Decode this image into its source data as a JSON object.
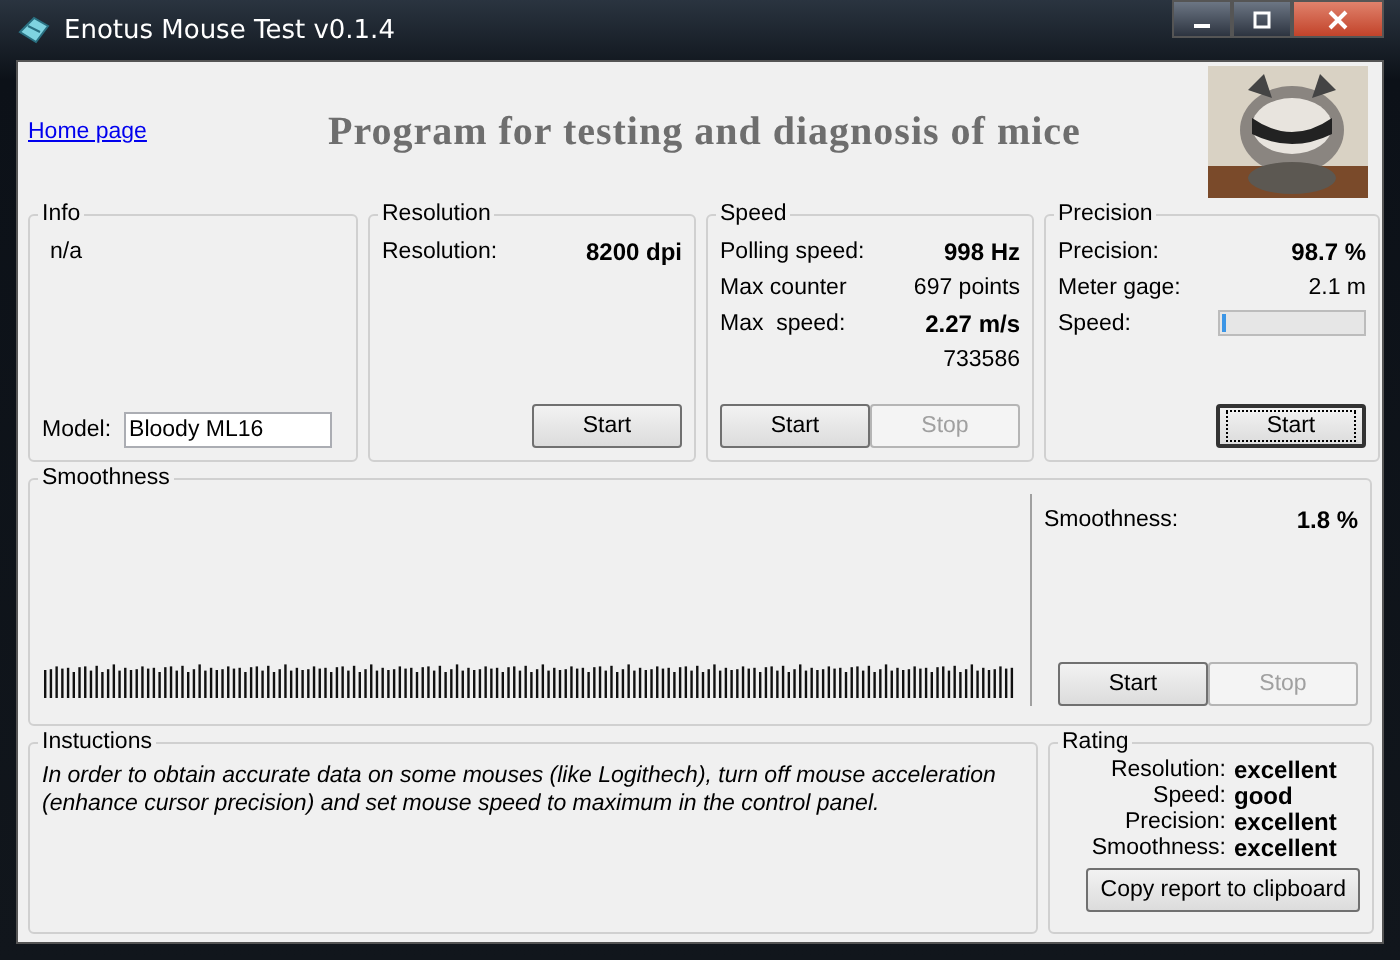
{
  "window": {
    "title": "Enotus Mouse Test v0.1.4"
  },
  "header": {
    "link": "Home page",
    "heading": "Program for testing and diagnosis of mice"
  },
  "info": {
    "title": "Info",
    "status": "n/a",
    "model_label": "Model:",
    "model_value": "Bloody ML16"
  },
  "panels": [
    {
      "title": "Resolution",
      "rows": [
        {
          "kind": "value",
          "label": "Resolution:",
          "value": "8200 dpi",
          "bold": true
        }
      ],
      "buttons": [
        {
          "label": "Start",
          "disabled": false,
          "focused": false
        }
      ]
    },
    {
      "title": "Speed",
      "rows": [
        {
          "kind": "value",
          "label": "Polling speed:",
          "value": "998 Hz",
          "bold": true
        },
        {
          "kind": "value",
          "label": "Max counter",
          "value": "697 points",
          "bold": false
        },
        {
          "kind": "value",
          "label": "Max  speed:",
          "value": "2.27 m/s",
          "bold": true
        },
        {
          "kind": "value",
          "value": "733586",
          "bold": false
        }
      ],
      "buttons": [
        {
          "label": "Start",
          "disabled": false,
          "focused": false
        },
        {
          "label": "Stop",
          "disabled": true,
          "focused": false
        }
      ]
    },
    {
      "title": "Precision",
      "rows": [
        {
          "kind": "value",
          "label": "Precision:",
          "value": "98.7 %",
          "bold": true
        },
        {
          "kind": "value",
          "label": "Meter gage:",
          "value": "2.1 m",
          "bold": false
        },
        {
          "kind": "meter",
          "label": "Speed:",
          "level": 0.03
        }
      ],
      "buttons": [
        {
          "label": "Start",
          "disabled": false,
          "focused": true
        }
      ]
    }
  ],
  "smoothness": {
    "title": "Smoothness",
    "label": "Smoothness:",
    "value": "1.8 %",
    "buttons": [
      {
        "label": "Start",
        "disabled": false,
        "focused": false
      },
      {
        "label": "Stop",
        "disabled": true,
        "focused": false
      }
    ]
  },
  "instructions": {
    "title": "Instuctions",
    "text": "In order to obtain accurate data on some mouses (like Logithech), turn off mouse acceleration (enhance cursor precision) and set mouse speed to maximum in the control panel."
  },
  "rating": {
    "title": "Rating",
    "rows": [
      {
        "label": "Resolution:",
        "value": "excellent"
      },
      {
        "label": "Speed:",
        "value": "good"
      },
      {
        "label": "Precision:",
        "value": "excellent"
      },
      {
        "label": "Smoothness:",
        "value": "excellent"
      }
    ],
    "button": "Copy report to clipboard"
  }
}
